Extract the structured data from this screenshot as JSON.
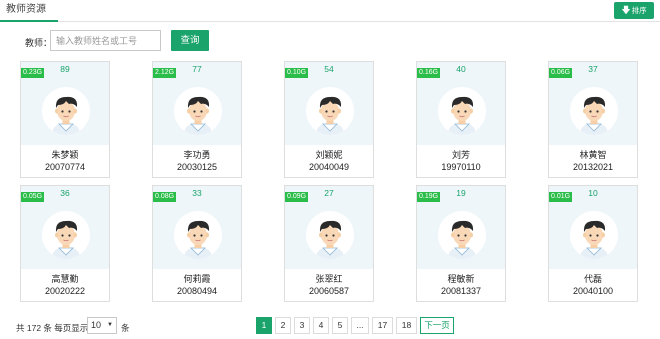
{
  "tabs": {
    "active_label": "教师资源"
  },
  "toolbar": {
    "sort_label": "排序",
    "sort_icon": "arrow-down-icon"
  },
  "search": {
    "label": "教师：",
    "placeholder": "输入教师姓名或工号",
    "value": "",
    "button_label": "查询"
  },
  "teachers": [
    {
      "size": "0.23G",
      "count": "89",
      "name": "朱梦颖",
      "id": "20070774"
    },
    {
      "size": "2.12G",
      "count": "77",
      "name": "李功勇",
      "id": "20030125"
    },
    {
      "size": "0.10G",
      "count": "54",
      "name": "刘颖妮",
      "id": "20040049"
    },
    {
      "size": "0.16G",
      "count": "40",
      "name": "刘芳",
      "id": "19970110"
    },
    {
      "size": "0.06G",
      "count": "37",
      "name": "林黄智",
      "id": "20132021"
    },
    {
      "size": "0.05G",
      "count": "36",
      "name": "高慧勤",
      "id": "20020222"
    },
    {
      "size": "0.08G",
      "count": "33",
      "name": "何莉霞",
      "id": "20080494"
    },
    {
      "size": "0.09G",
      "count": "27",
      "name": "张翠红",
      "id": "20060587"
    },
    {
      "size": "0.19G",
      "count": "19",
      "name": "程敏新",
      "id": "20081337"
    },
    {
      "size": "0.01G",
      "count": "10",
      "name": "代磊",
      "id": "20040100"
    }
  ],
  "footer": {
    "total_text": "共 172 条 每页显示",
    "page_size": "10",
    "unit": "条"
  },
  "pagination": {
    "pages": [
      "1",
      "2",
      "3",
      "4",
      "5",
      "...",
      "17",
      "18"
    ],
    "active": "1",
    "next_label": "下一页"
  },
  "colors": {
    "accent": "#1aa36b",
    "size_badge": "#2bbd49",
    "photo_bg": "#eff6f9"
  }
}
